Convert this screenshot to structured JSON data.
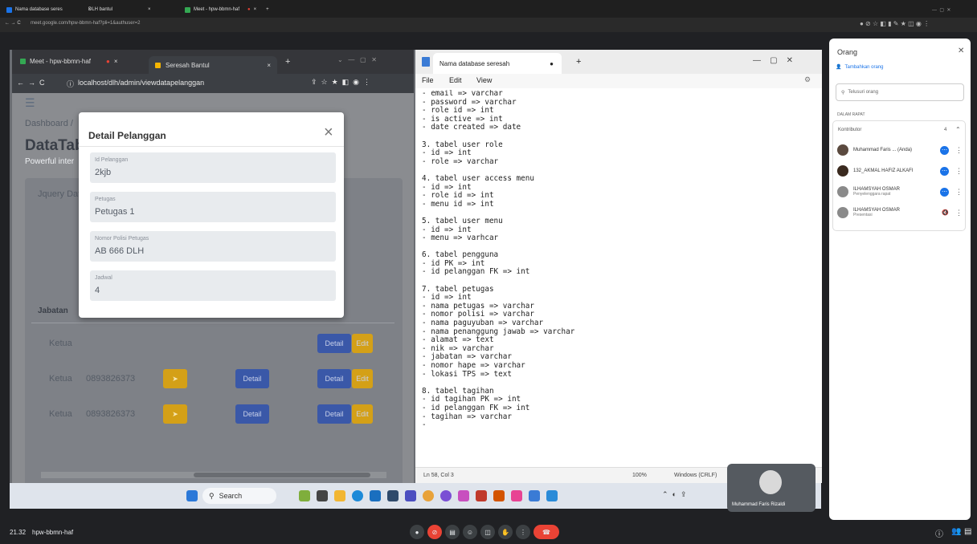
{
  "outer_browser": {
    "tabs": [
      "Nama database seres",
      "DLH bantul",
      "Meet - hpw-bbmn-haf"
    ],
    "url": "meet.google.com/hpw-bbmn-haf?pli=1&authuser=2"
  },
  "inner_browser": {
    "tabs": [
      "Meet - hpw-bbmn-haf",
      "Seresah Bantul"
    ],
    "url": "localhost/dlh/admin/viewdatapelanggan"
  },
  "page": {
    "breadcrumb": "Dashboard /",
    "title": "DataTab",
    "subtitle": "Powerful inter",
    "card_title": "Jquery Dat",
    "col_header": "Jabatan",
    "rows": [
      {
        "jabatan": "Ketua",
        "phone": "",
        "detail1": "Detail",
        "detail2": "Detail",
        "edit": "Edit"
      },
      {
        "jabatan": "Ketua",
        "phone": "0893826373",
        "detail1": "Detail",
        "detail2": "Detail",
        "edit": "Edit"
      },
      {
        "jabatan": "Ketua",
        "phone": "0893826373",
        "detail1": "Detail",
        "detail2": "Detail",
        "edit": "Edit"
      }
    ]
  },
  "modal": {
    "title": "Detail Pelanggan",
    "close": "×",
    "fields": [
      {
        "label": "Id Pelanggan",
        "value": "2kjb"
      },
      {
        "label": "Petugas",
        "value": "Petugas 1"
      },
      {
        "label": "Nomor Polisi Petugas",
        "value": "AB 666 DLH"
      },
      {
        "label": "Jadwal",
        "value": "4"
      }
    ]
  },
  "notepad": {
    "title": "Nama database seresah",
    "menu": [
      "File",
      "Edit",
      "View"
    ],
    "lines": [
      "- email => varchar",
      "- password => varchar",
      "- role id => int",
      "- is active => int",
      "- date created => date",
      "",
      "3. tabel user role",
      "- id => int",
      "- role => varchar",
      "",
      "4. tabel user access menu",
      "- id => int",
      "- role id => int",
      "- menu id => int",
      "",
      "5. tabel user menu",
      "- id => int",
      "- menu => varhcar",
      "",
      "6. tabel pengguna",
      "- id PK => int",
      "- id pelanggan FK => int",
      "",
      "7. tabel petugas",
      "- id => int",
      "- nama petugas => varchar",
      "- nomor polisi => varchar",
      "- nama paguyuban => varchar",
      "- nama penanggung jawab => varchar",
      "- alamat => text",
      "- nik => varchar",
      "- jabatan => varchar",
      "- nomor hape => varchar",
      "- lokasi TPS => text",
      "",
      "8. tabel tagihan",
      "- id tagihan PK => int",
      "- id pelanggan FK => int",
      "- tagihan => varchar",
      "-"
    ],
    "status": {
      "pos": "Ln 58, Col 3",
      "zoom": "100%",
      "eol": "Windows (CRLF)"
    }
  },
  "taskbar": {
    "search": "Search"
  },
  "self_video": {
    "name": "Muhammad Faris Rizaldi"
  },
  "people_panel": {
    "title": "Orang",
    "add": "Tambahkan orang",
    "search_placeholder": "Telusuri orang",
    "section": "DALAM RAPAT",
    "group": "Kontributor",
    "group_count": "4",
    "people": [
      {
        "name": "Muhammad Faris ... (Anda)",
        "role": ""
      },
      {
        "name": "132_AKMAL HAFIZ ALKAFI",
        "role": ""
      },
      {
        "name": "ILHAMSYAH OSMAR",
        "role": "Penyelenggara rapat"
      },
      {
        "name": "ILHAMSYAH OSMAR",
        "role": "Presentasi"
      }
    ]
  },
  "meet_bar": {
    "time": "21.32",
    "code": "hpw-bbmn-haf"
  },
  "colors": {
    "meet_bg": "#202124",
    "hangup": "#ea4335",
    "primary": "#1a73e8",
    "edit": "#d4a017",
    "detail": "#3a58a8"
  }
}
